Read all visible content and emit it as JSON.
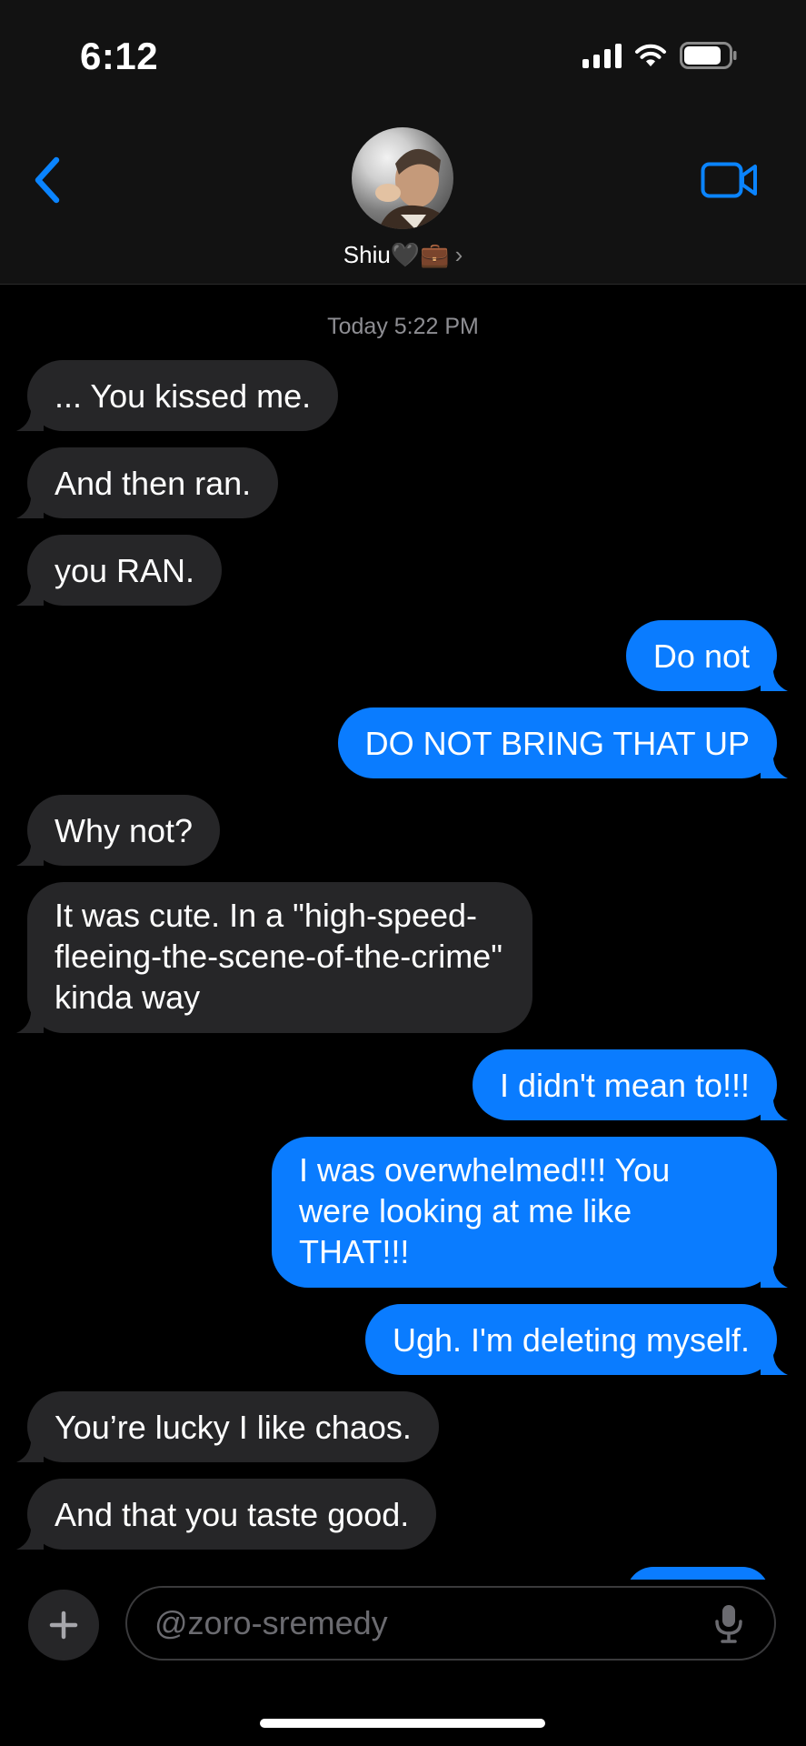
{
  "status_bar": {
    "time": "6:12"
  },
  "header": {
    "contact_name": "Shiu",
    "emoji": "🖤💼",
    "chevron": "›"
  },
  "timestamp": "Today 5:22 PM",
  "messages": [
    {
      "dir": "in",
      "text": "... You kissed me."
    },
    {
      "dir": "in",
      "text": "And then ran."
    },
    {
      "dir": "in",
      "text": "you RAN."
    },
    {
      "dir": "out",
      "text": "Do not"
    },
    {
      "dir": "out",
      "text": "DO NOT BRING THAT UP"
    },
    {
      "dir": "in",
      "text": "Why not?"
    },
    {
      "dir": "in",
      "text": "It was cute. In a \"high-speed-fleeing-the-scene-of-the-crime\" kinda way"
    },
    {
      "dir": "out",
      "text": "I didn't mean to!!!"
    },
    {
      "dir": "out",
      "text": "I was overwhelmed!!! You were looking at me like THAT!!!"
    },
    {
      "dir": "out",
      "text": "Ugh. I'm deleting myself."
    },
    {
      "dir": "in",
      "text": "You’re lucky I like chaos."
    },
    {
      "dir": "in",
      "text": "And that you taste good."
    }
  ],
  "composer": {
    "placeholder": "@zoro-sremedy"
  },
  "colors": {
    "outgoing_bubble": "#0a7cff",
    "incoming_bubble": "#262628",
    "accent": "#0a7cff"
  },
  "icons": [
    "back-chevron-icon",
    "video-camera-icon",
    "plus-icon",
    "microphone-icon",
    "signal-icon",
    "wifi-icon",
    "battery-icon"
  ]
}
